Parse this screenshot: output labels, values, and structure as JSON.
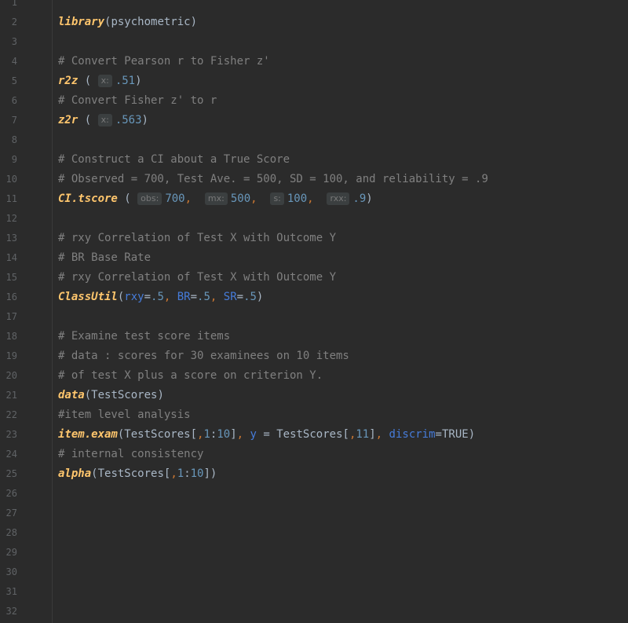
{
  "gutter": {
    "line_numbers": [
      "1",
      "2",
      "3",
      "4",
      "5",
      "6",
      "7",
      "8",
      "9",
      "10",
      "11",
      "12",
      "13",
      "14",
      "15",
      "16",
      "17",
      "18",
      "19",
      "20",
      "21",
      "22",
      "23",
      "24",
      "25",
      "26",
      "27",
      "28",
      "29",
      "30",
      "31",
      "32"
    ]
  },
  "code": {
    "l2": {
      "fn": "library",
      "open": "(",
      "arg": "psychometric",
      "close": ")"
    },
    "l4": "# Convert Pearson r to Fisher z'",
    "l5": {
      "fn": "r2z",
      "open": " (",
      "hint": "x:",
      "num": ".51",
      "close": ")"
    },
    "l6": "# Convert Fisher z' to r",
    "l7": {
      "fn": "z2r",
      "open": " (",
      "hint": "x:",
      "num": ".563",
      "close": ")"
    },
    "l9": "# Construct a CI about a True Score",
    "l10": "# Observed = 700, Test Ave. = 500, SD = 100, and reliability = .9",
    "l11": {
      "fn": "CI.tscore",
      "open": " (",
      "h1": "obs:",
      "n1": "700",
      "c": ",",
      "h2": "mx:",
      "n2": "500",
      "h3": "s:",
      "n3": "100",
      "h4": "rxx:",
      "n4": ".9",
      "close": ")"
    },
    "l13": "# rxy Correlation of Test X with Outcome Y",
    "l14": "# BR Base Rate",
    "l15": "# rxy Correlation of Test X with Outcome Y",
    "l16": {
      "fn": "ClassUtil",
      "open": "(",
      "a1": "rxy",
      "eq": "=",
      "n1": ".5",
      "c": ", ",
      "a2": "BR",
      "n2": ".5",
      "a3": "SR",
      "n3": ".5",
      "close": ")"
    },
    "l18": "# Examine test score items",
    "l19": "# data : scores for 30 examinees on 10 items",
    "l20": "# of test X plus a score on criterion Y.",
    "l21": {
      "fn": "data",
      "open": "(",
      "arg": "TestScores",
      "close": ")"
    },
    "l22": "#item level analysis",
    "l23": {
      "fn": "item.exam",
      "open": "(",
      "a": "TestScores[",
      "c1": ",",
      "n1": "1",
      "colon": ":",
      "n2": "10",
      "b": "]",
      "c2": ", ",
      "y": "y",
      "eq": " = ",
      "d": "TestScores[",
      "n3": "11",
      "e": "]",
      "c3": ", ",
      "disc": "discrim",
      "eq2": "=",
      "t": "TRUE",
      "close": ")"
    },
    "l24": "# internal consistency",
    "l25": {
      "fn": "alpha",
      "open": "(",
      "a": "TestScores[",
      "c1": ",",
      "n1": "1",
      "colon": ":",
      "n2": "10",
      "b": "])"
    }
  }
}
